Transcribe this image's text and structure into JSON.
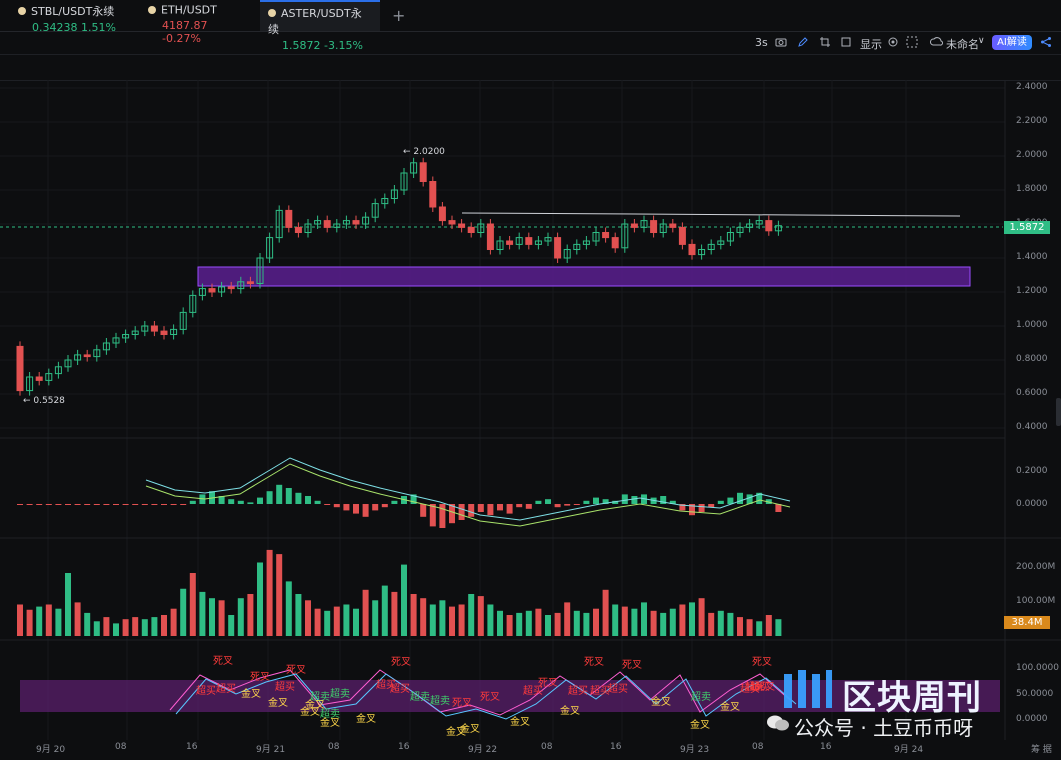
{
  "tabs": [
    {
      "symbol": "STBL/USDT永续",
      "price": "0.34238",
      "change": "1.51%",
      "dir": "up"
    },
    {
      "symbol": "ETH/USDT",
      "price": "4187.87",
      "change": "-0.27%",
      "dir": "down"
    },
    {
      "symbol": "ASTER/USDT永续",
      "price": "1.5872",
      "change": "-3.15%",
      "dir": "down",
      "active": true
    }
  ],
  "toolbar": {
    "interval": "3s",
    "display": "显示",
    "layout_name": "未命名",
    "ai_label": "AI解读"
  },
  "price_axis": [
    "2.4000",
    "2.2000",
    "2.0000",
    "1.8000",
    "1.6000",
    "1.4000",
    "1.2000",
    "1.0000",
    "0.8000",
    "0.6000",
    "0.4000"
  ],
  "current_price": "1.5872",
  "annotations": {
    "high": "← 2.0200",
    "low": "← 0.5528"
  },
  "macd_axis": [
    "0.2000",
    "0.0000"
  ],
  "volume_axis": [
    "200.00M",
    "100.00M"
  ],
  "volume_current": "38.4M",
  "kdj_axis": [
    "100.0000",
    "50.0000",
    "0.0000"
  ],
  "time_labels": [
    "9月 20",
    "08",
    "16",
    "9月 21",
    "08",
    "16",
    "9月 22",
    "08",
    "16",
    "9月 23",
    "08",
    "16",
    "9月 24"
  ],
  "corner_label": "筹 据",
  "signals": [
    {
      "t": "死叉",
      "c": "red"
    },
    {
      "t": "超买",
      "c": "red"
    },
    {
      "t": "超买",
      "c": "red"
    },
    {
      "t": "死叉",
      "c": "red"
    },
    {
      "t": "金叉",
      "c": "yellow"
    },
    {
      "t": "金叉",
      "c": "yellow"
    },
    {
      "t": "死叉",
      "c": "red"
    },
    {
      "t": "超买",
      "c": "red"
    },
    {
      "t": "超卖",
      "c": "green"
    },
    {
      "t": "超卖",
      "c": "green"
    },
    {
      "t": "超卖",
      "c": "green"
    },
    {
      "t": "金叉",
      "c": "yellow"
    },
    {
      "t": "金叉",
      "c": "yellow"
    },
    {
      "t": "金叉",
      "c": "yellow"
    },
    {
      "t": "死叉",
      "c": "red"
    },
    {
      "t": "超买",
      "c": "red"
    },
    {
      "t": "超买",
      "c": "red"
    },
    {
      "t": "超卖",
      "c": "green"
    },
    {
      "t": "超卖",
      "c": "green"
    },
    {
      "t": "死叉",
      "c": "red"
    },
    {
      "t": "金叉",
      "c": "yellow"
    },
    {
      "t": "金叉",
      "c": "yellow"
    },
    {
      "t": "死叉",
      "c": "red"
    },
    {
      "t": "金叉",
      "c": "yellow"
    },
    {
      "t": "超买",
      "c": "red"
    },
    {
      "t": "死叉",
      "c": "red"
    },
    {
      "t": "金叉",
      "c": "yellow"
    },
    {
      "t": "死叉",
      "c": "red"
    },
    {
      "t": "超买",
      "c": "red"
    },
    {
      "t": "超买",
      "c": "red"
    },
    {
      "t": "死叉",
      "c": "red"
    },
    {
      "t": "金叉",
      "c": "yellow"
    },
    {
      "t": "超买",
      "c": "red"
    },
    {
      "t": "金叉",
      "c": "yellow"
    },
    {
      "t": "超卖",
      "c": "green"
    },
    {
      "t": "死叉",
      "c": "red"
    },
    {
      "t": "超买",
      "c": "red"
    },
    {
      "t": "超买",
      "c": "red"
    },
    {
      "t": "金叉",
      "c": "yellow"
    },
    {
      "t": "金叉",
      "c": "yellow"
    },
    {
      "t": "死叉",
      "c": "red"
    },
    {
      "t": "超买",
      "c": "red"
    }
  ],
  "watermark": {
    "brand": "区块周刊",
    "account": "公众号 · 土豆币币呀"
  },
  "colors": {
    "up": "#2fbd85",
    "down": "#e25151",
    "zone": "#5a1f8f",
    "accent": "#2b6fe8"
  }
}
